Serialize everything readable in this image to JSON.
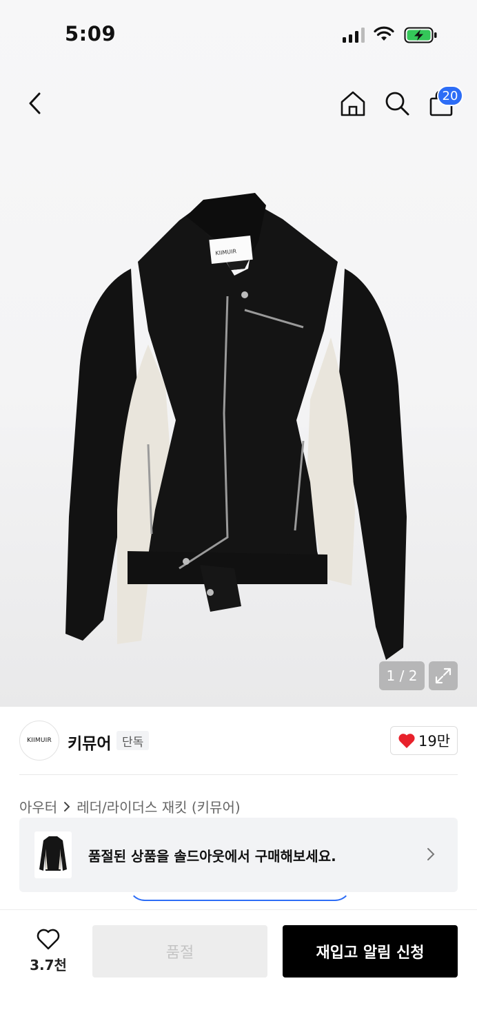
{
  "status": {
    "time": "5:09"
  },
  "header": {
    "cart_count": "20"
  },
  "product_image": {
    "label_text": "KIIMUIR",
    "counter": "1 / 2"
  },
  "brand": {
    "logo_text": "KIIMUIR",
    "name": "키뮤어",
    "badge": "단독",
    "likes": "19만"
  },
  "breadcrumb": {
    "items": [
      "아우터",
      "레더/라이더스 재킷 (키뮤어)"
    ]
  },
  "soldout_banner": {
    "text": "품절된 상품을 솔드아웃에서 구매해보세요."
  },
  "bottom_bar": {
    "wishlist_count": "3.7천",
    "soldout_label": "품절",
    "restock_label": "재입고 알림 신청"
  },
  "colors": {
    "accent_blue": "#2d6df6",
    "heart_red": "#e8212b",
    "black": "#000000"
  }
}
